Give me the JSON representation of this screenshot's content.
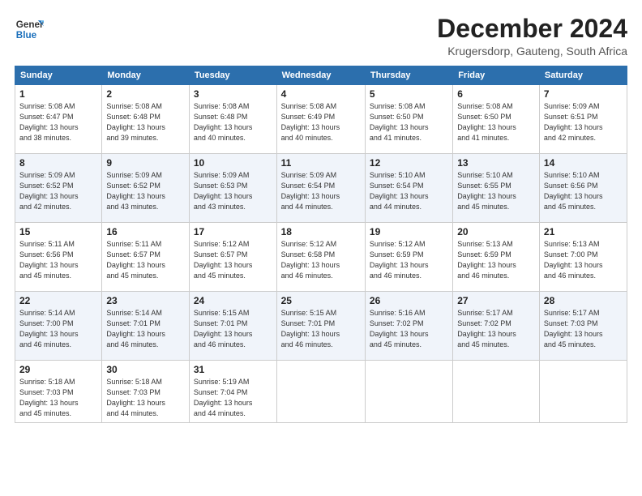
{
  "header": {
    "logo_line1": "General",
    "logo_line2": "Blue",
    "title": "December 2024",
    "subtitle": "Krugersdorp, Gauteng, South Africa"
  },
  "days_of_week": [
    "Sunday",
    "Monday",
    "Tuesday",
    "Wednesday",
    "Thursday",
    "Friday",
    "Saturday"
  ],
  "weeks": [
    [
      {
        "day": "1",
        "info": "Sunrise: 5:08 AM\nSunset: 6:47 PM\nDaylight: 13 hours\nand 38 minutes."
      },
      {
        "day": "2",
        "info": "Sunrise: 5:08 AM\nSunset: 6:48 PM\nDaylight: 13 hours\nand 39 minutes."
      },
      {
        "day": "3",
        "info": "Sunrise: 5:08 AM\nSunset: 6:48 PM\nDaylight: 13 hours\nand 40 minutes."
      },
      {
        "day": "4",
        "info": "Sunrise: 5:08 AM\nSunset: 6:49 PM\nDaylight: 13 hours\nand 40 minutes."
      },
      {
        "day": "5",
        "info": "Sunrise: 5:08 AM\nSunset: 6:50 PM\nDaylight: 13 hours\nand 41 minutes."
      },
      {
        "day": "6",
        "info": "Sunrise: 5:08 AM\nSunset: 6:50 PM\nDaylight: 13 hours\nand 41 minutes."
      },
      {
        "day": "7",
        "info": "Sunrise: 5:09 AM\nSunset: 6:51 PM\nDaylight: 13 hours\nand 42 minutes."
      }
    ],
    [
      {
        "day": "8",
        "info": "Sunrise: 5:09 AM\nSunset: 6:52 PM\nDaylight: 13 hours\nand 42 minutes."
      },
      {
        "day": "9",
        "info": "Sunrise: 5:09 AM\nSunset: 6:52 PM\nDaylight: 13 hours\nand 43 minutes."
      },
      {
        "day": "10",
        "info": "Sunrise: 5:09 AM\nSunset: 6:53 PM\nDaylight: 13 hours\nand 43 minutes."
      },
      {
        "day": "11",
        "info": "Sunrise: 5:09 AM\nSunset: 6:54 PM\nDaylight: 13 hours\nand 44 minutes."
      },
      {
        "day": "12",
        "info": "Sunrise: 5:10 AM\nSunset: 6:54 PM\nDaylight: 13 hours\nand 44 minutes."
      },
      {
        "day": "13",
        "info": "Sunrise: 5:10 AM\nSunset: 6:55 PM\nDaylight: 13 hours\nand 45 minutes."
      },
      {
        "day": "14",
        "info": "Sunrise: 5:10 AM\nSunset: 6:56 PM\nDaylight: 13 hours\nand 45 minutes."
      }
    ],
    [
      {
        "day": "15",
        "info": "Sunrise: 5:11 AM\nSunset: 6:56 PM\nDaylight: 13 hours\nand 45 minutes."
      },
      {
        "day": "16",
        "info": "Sunrise: 5:11 AM\nSunset: 6:57 PM\nDaylight: 13 hours\nand 45 minutes."
      },
      {
        "day": "17",
        "info": "Sunrise: 5:12 AM\nSunset: 6:57 PM\nDaylight: 13 hours\nand 45 minutes."
      },
      {
        "day": "18",
        "info": "Sunrise: 5:12 AM\nSunset: 6:58 PM\nDaylight: 13 hours\nand 46 minutes."
      },
      {
        "day": "19",
        "info": "Sunrise: 5:12 AM\nSunset: 6:59 PM\nDaylight: 13 hours\nand 46 minutes."
      },
      {
        "day": "20",
        "info": "Sunrise: 5:13 AM\nSunset: 6:59 PM\nDaylight: 13 hours\nand 46 minutes."
      },
      {
        "day": "21",
        "info": "Sunrise: 5:13 AM\nSunset: 7:00 PM\nDaylight: 13 hours\nand 46 minutes."
      }
    ],
    [
      {
        "day": "22",
        "info": "Sunrise: 5:14 AM\nSunset: 7:00 PM\nDaylight: 13 hours\nand 46 minutes."
      },
      {
        "day": "23",
        "info": "Sunrise: 5:14 AM\nSunset: 7:01 PM\nDaylight: 13 hours\nand 46 minutes."
      },
      {
        "day": "24",
        "info": "Sunrise: 5:15 AM\nSunset: 7:01 PM\nDaylight: 13 hours\nand 46 minutes."
      },
      {
        "day": "25",
        "info": "Sunrise: 5:15 AM\nSunset: 7:01 PM\nDaylight: 13 hours\nand 46 minutes."
      },
      {
        "day": "26",
        "info": "Sunrise: 5:16 AM\nSunset: 7:02 PM\nDaylight: 13 hours\nand 45 minutes."
      },
      {
        "day": "27",
        "info": "Sunrise: 5:17 AM\nSunset: 7:02 PM\nDaylight: 13 hours\nand 45 minutes."
      },
      {
        "day": "28",
        "info": "Sunrise: 5:17 AM\nSunset: 7:03 PM\nDaylight: 13 hours\nand 45 minutes."
      }
    ],
    [
      {
        "day": "29",
        "info": "Sunrise: 5:18 AM\nSunset: 7:03 PM\nDaylight: 13 hours\nand 45 minutes."
      },
      {
        "day": "30",
        "info": "Sunrise: 5:18 AM\nSunset: 7:03 PM\nDaylight: 13 hours\nand 44 minutes."
      },
      {
        "day": "31",
        "info": "Sunrise: 5:19 AM\nSunset: 7:04 PM\nDaylight: 13 hours\nand 44 minutes."
      },
      null,
      null,
      null,
      null
    ]
  ]
}
